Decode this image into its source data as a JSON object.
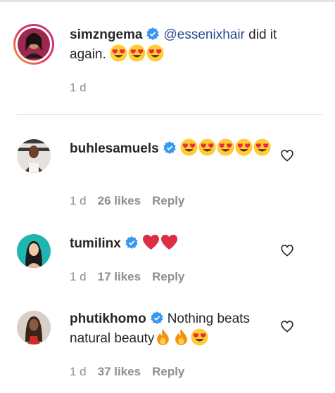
{
  "caption": {
    "username": "simzngema",
    "mention": "@essenixhair",
    "text": " did it again.",
    "emojis": [
      "heart-eyes",
      "heart-eyes",
      "heart-eyes"
    ],
    "time": "1 d"
  },
  "comments": [
    {
      "username": "buhlesamuels",
      "text": "",
      "emojis": [
        "heart-eyes",
        "heart-eyes",
        "heart-eyes",
        "heart-eyes",
        "heart-eyes"
      ],
      "time": "1 d",
      "likes": "26 likes",
      "reply": "Reply"
    },
    {
      "username": "tumilinx",
      "text": "",
      "emojis": [
        "red-heart",
        "red-heart"
      ],
      "time": "1 d",
      "likes": "17 likes",
      "reply": "Reply"
    },
    {
      "username": "phutikhomo",
      "text": "Nothing beats natural beauty",
      "emojis": [
        "fire",
        "fire",
        "heart-eyes"
      ],
      "time": "1 d",
      "likes": "37 likes",
      "reply": "Reply"
    }
  ],
  "colors": {
    "text": "#262626",
    "meta": "#8e8e8e",
    "mention": "#2a4c8f",
    "verified": "#3897f0",
    "divider": "#dbdbdb"
  }
}
